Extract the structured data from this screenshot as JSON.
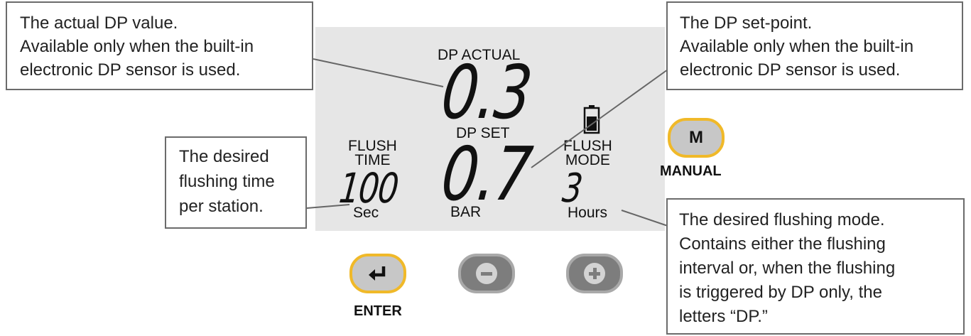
{
  "callouts": {
    "actual": [
      "The actual DP value.",
      "Available only when the built-in",
      "electronic DP sensor is used."
    ],
    "set": [
      "The DP set-point.",
      "Available only when the built-in",
      "electronic DP sensor is used."
    ],
    "flush_time": [
      "The desired",
      "flushing time",
      "per station."
    ],
    "flush_mode": [
      "The desired flushing mode.",
      "Contains either the flushing",
      "interval or, when the flushing",
      "is triggered by DP only, the",
      "letters “DP.”"
    ]
  },
  "display": {
    "dp_actual_label": "DP ACTUAL",
    "dp_actual_value": "0.3",
    "dp_set_label": "DP SET",
    "dp_set_value": "0.7",
    "bar_unit": "BAR",
    "flush_time_label_1": "FLUSH",
    "flush_time_label_2": "TIME",
    "flush_time_value": "100",
    "sec_unit": "Sec",
    "flush_mode_label_1": "FLUSH",
    "flush_mode_label_2": "MODE",
    "flush_mode_value": "3",
    "hours_unit": "Hours"
  },
  "buttons": {
    "manual_key": "M",
    "manual_label": "MANUAL",
    "enter_label": "ENTER"
  },
  "colors": {
    "lcd_background": "#e6e6e6",
    "button_gold_border": "#f0b929",
    "button_grey": "#7d7d7d",
    "callout_border": "#6b6b6b"
  }
}
